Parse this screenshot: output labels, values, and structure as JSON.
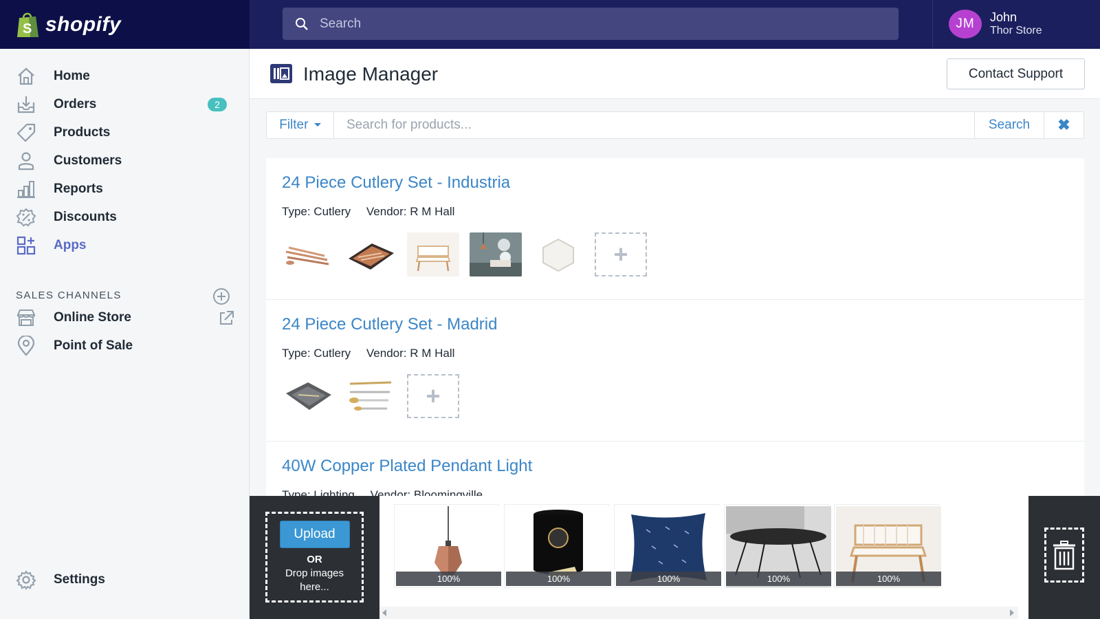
{
  "brand": {
    "name": "shopify"
  },
  "topbar": {
    "search_placeholder": "Search",
    "user": {
      "initials": "JM",
      "name": "John",
      "store": "Thor Store"
    }
  },
  "sidebar": {
    "items": [
      {
        "label": "Home",
        "icon": "home-icon"
      },
      {
        "label": "Orders",
        "icon": "orders-icon",
        "badge": "2"
      },
      {
        "label": "Products",
        "icon": "tag-icon"
      },
      {
        "label": "Customers",
        "icon": "person-icon"
      },
      {
        "label": "Reports",
        "icon": "bar-chart-icon"
      },
      {
        "label": "Discounts",
        "icon": "discount-icon"
      },
      {
        "label": "Apps",
        "icon": "apps-icon",
        "active": true
      }
    ],
    "sales_channels_heading": "SALES CHANNELS",
    "channels": [
      {
        "label": "Online Store",
        "icon": "storefront-icon"
      },
      {
        "label": "Point of Sale",
        "icon": "location-pin-icon"
      }
    ],
    "settings_label": "Settings"
  },
  "page": {
    "title": "Image Manager",
    "contact_support": "Contact Support"
  },
  "filterbar": {
    "filter_label": "Filter",
    "search_placeholder": "Search for products...",
    "search_label": "Search",
    "clear_symbol": "✖"
  },
  "products": [
    {
      "name": "24 Piece Cutlery Set - Industria",
      "type": "Type: Cutlery",
      "vendor": "Vendor: R M Hall",
      "images": [
        "cutlery-copper",
        "cutlery-boxed",
        "chair",
        "pendant-lights",
        "hexagon-mirror"
      ]
    },
    {
      "name": "24 Piece Cutlery Set - Madrid",
      "type": "Type: Cutlery",
      "vendor": "Vendor: R M Hall",
      "images": [
        "cutlery-grey-box",
        "cutlery-gold"
      ]
    },
    {
      "name": "40W Copper Plated Pendant Light",
      "type": "Type: Lighting",
      "vendor": "Vendor: Bloomingville",
      "images": []
    }
  ],
  "upload": {
    "button_label": "Upload",
    "or_text": "OR",
    "drop_text": "Drop images here...",
    "tray": [
      {
        "image": "copper-pendant",
        "progress": "100%"
      },
      {
        "image": "black-canister",
        "progress": "100%"
      },
      {
        "image": "navy-cushion",
        "progress": "100%"
      },
      {
        "image": "black-table",
        "progress": "100%"
      },
      {
        "image": "woven-chair",
        "progress": "100%"
      }
    ]
  },
  "colors": {
    "topbar": "#1b1f5e",
    "brand_bg": "#0d1048",
    "link": "#3b86c7",
    "badge": "#47c1bf",
    "avatar": "#b641d1",
    "upload_button": "#3b98d4"
  }
}
